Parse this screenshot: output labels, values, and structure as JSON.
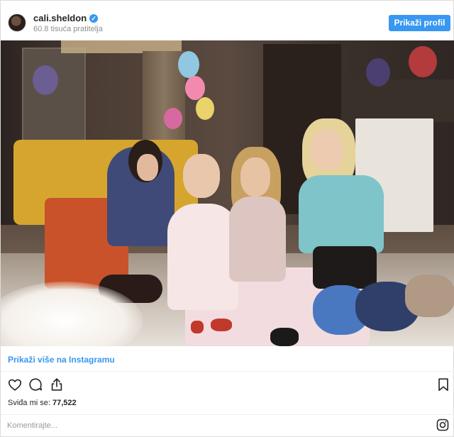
{
  "header": {
    "username": "cali.sheldon",
    "verified": true,
    "followers": "60.8 tisuća pratitelja",
    "profile_button": "Prikaži profil"
  },
  "post": {
    "more_link": "Prikaži više na Instagramu",
    "likes_label": "Sviđa mi se:",
    "likes_count": "77,522",
    "comment_placeholder": "Komentirajte..."
  },
  "icons": {
    "like": "heart-icon",
    "comment": "comment-icon",
    "share": "share-icon",
    "save": "bookmark-icon",
    "brand": "instagram-icon"
  },
  "colors": {
    "accent": "#3897f0",
    "text": "#262626",
    "muted": "#8e8e8e"
  }
}
